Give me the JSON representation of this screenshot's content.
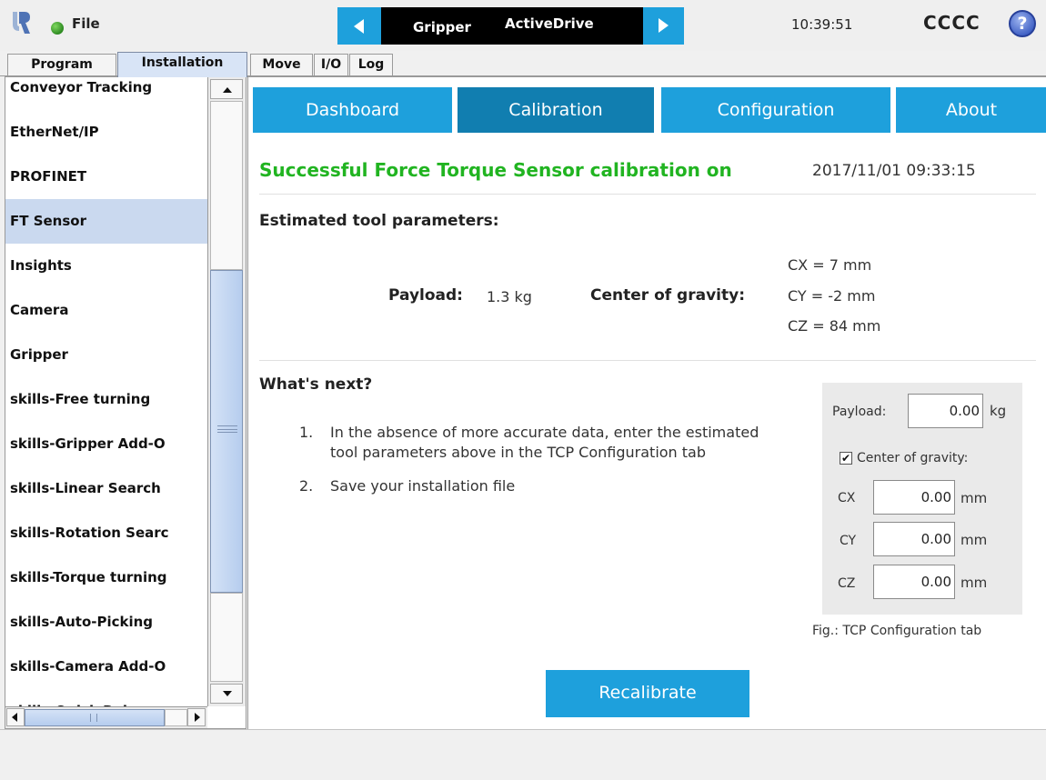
{
  "header": {
    "file_menu": "File",
    "nav_left": "Gripper",
    "nav_right": "ActiveDrive",
    "clock": "10:39:51",
    "robot_name": "CCCC",
    "help": "?"
  },
  "tabs": [
    {
      "label": "Program",
      "active": false
    },
    {
      "label": "Installation",
      "active": true
    },
    {
      "label": "Move",
      "active": false
    },
    {
      "label": "I/O",
      "active": false
    },
    {
      "label": "Log",
      "active": false
    }
  ],
  "sidebar": {
    "items": [
      {
        "label": "Conveyor Tracking"
      },
      {
        "label": "EtherNet/IP"
      },
      {
        "label": "PROFINET"
      },
      {
        "label": "FT Sensor",
        "selected": true
      },
      {
        "label": "Insights"
      },
      {
        "label": "Camera"
      },
      {
        "label": "Gripper"
      },
      {
        "label": "skills-Free turning"
      },
      {
        "label": "skills-Gripper Add-O"
      },
      {
        "label": "skills-Linear Search"
      },
      {
        "label": "skills-Rotation Searc"
      },
      {
        "label": "skills-Torque turning"
      },
      {
        "label": "skills-Auto-Picking"
      },
      {
        "label": "skills-Camera Add-O"
      },
      {
        "label": "skills-Quick Release"
      }
    ]
  },
  "subtabs": [
    {
      "label": "Dashboard",
      "active": false
    },
    {
      "label": "Calibration",
      "active": true
    },
    {
      "label": "Configuration",
      "active": false
    },
    {
      "label": "About",
      "active": false
    }
  ],
  "calibration": {
    "status_text": "Successful Force Torque Sensor calibration on",
    "status_date": "2017/11/01 09:33:15",
    "estimated_title": "Estimated tool parameters:",
    "payload_label": "Payload:",
    "payload_value": "1.3 kg",
    "cog_label": "Center of gravity:",
    "cx": "CX = 7 mm",
    "cy": "CY = -2 mm",
    "cz": "CZ = 84 mm",
    "next_title": "What's next?",
    "steps": [
      {
        "num": "1.",
        "text": "In the absence of more accurate data, enter the estimated tool parameters above in the TCP Configuration tab"
      },
      {
        "num": "2.",
        "text": "Save your installation file"
      }
    ],
    "recalibrate_label": "Recalibrate"
  },
  "tcp_figure": {
    "payload_label": "Payload:",
    "payload_value": "0.00",
    "payload_unit": "kg",
    "cog_checkbox_label": "Center of gravity:",
    "cog_checked": true,
    "cx_label": "CX",
    "cx_value": "0.00",
    "cy_label": "CY",
    "cy_value": "0.00",
    "cz_label": "CZ",
    "cz_value": "0.00",
    "unit": "mm",
    "caption": "Fig.: TCP Configuration tab"
  },
  "colors": {
    "accent_blue": "#1ea0dc",
    "active_subtab": "#117eb0",
    "success_green": "#21b421",
    "selected_item": "#cad9ef"
  }
}
